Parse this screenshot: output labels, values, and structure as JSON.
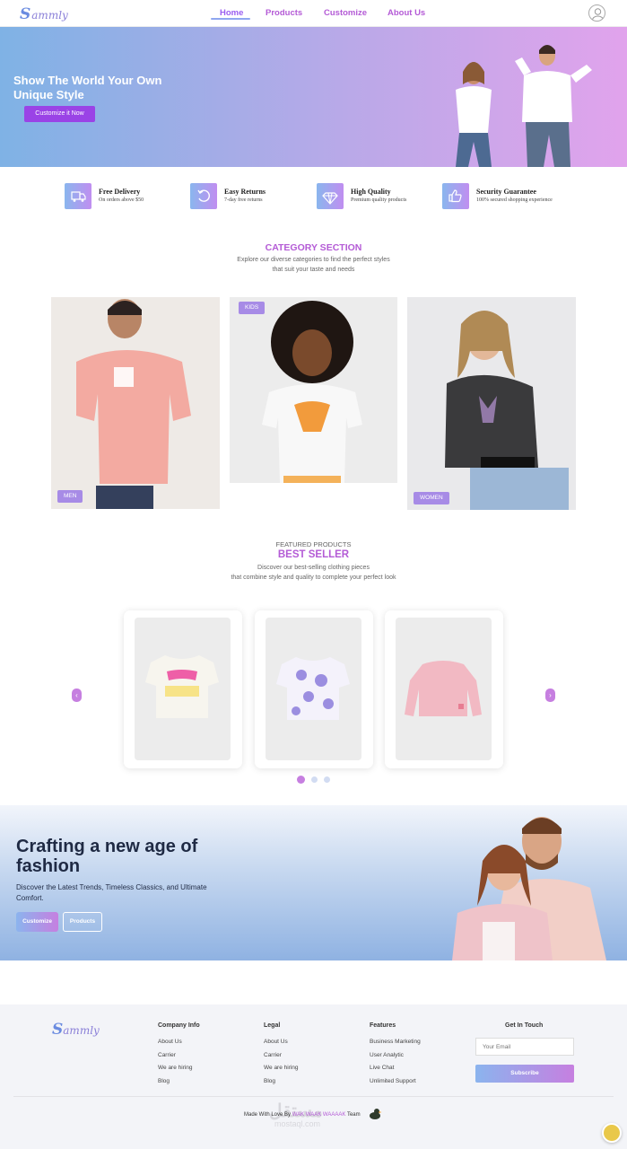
{
  "nav": {
    "logo_mark": "S",
    "logo_text": "ammly",
    "links": [
      {
        "label": "Home"
      },
      {
        "label": "Products"
      },
      {
        "label": "Customize"
      },
      {
        "label": "About Us"
      }
    ],
    "active_link": "Home"
  },
  "hero": {
    "title": "Show The World Your Own Unique Style",
    "button": "Customize it Now"
  },
  "features": [
    {
      "icon": "truck-icon",
      "title": "Free Delivery",
      "subtitle": "On orders above $50"
    },
    {
      "icon": "return-icon",
      "title": "Easy Returns",
      "subtitle": "7-day free returns"
    },
    {
      "icon": "diamond-icon",
      "title": "High Quality",
      "subtitle": "Premium quality products"
    },
    {
      "icon": "thumbs-up-icon",
      "title": "Security Guarantee",
      "subtitle": "100% secured shopping experience"
    }
  ],
  "category": {
    "title": "CATEGORY SECTION",
    "desc_line1": "Explore our diverse categories to find the perfect styles",
    "desc_line2": "that suit your taste and needs",
    "items": [
      {
        "label": "MEN"
      },
      {
        "label": "KIDS"
      },
      {
        "label": "WOMEN"
      }
    ]
  },
  "best_seller": {
    "eyebrow": "FEATURED PRODUCTS",
    "title": "BEST SELLER",
    "desc_line1": "Discover our best-selling clothing pieces",
    "desc_line2": "that combine style and quality to complete your perfect look",
    "prev": "‹",
    "next": "›",
    "active_dot": 1,
    "dot_count": 3
  },
  "banner": {
    "title": "Crafting a new age of fashion",
    "desc": "Discover the Latest Trends, Timeless Classics, and Ultimate Comfort.",
    "btn_primary": "Customize",
    "btn_secondary": "Products"
  },
  "footer": {
    "logo_mark": "S",
    "logo_text": "ammly",
    "columns": [
      {
        "title": "Company Info",
        "items": [
          "About Us",
          "Carrier",
          "We are hiring",
          "Blog"
        ]
      },
      {
        "title": "Legal",
        "items": [
          "About Us",
          "Carrier",
          "We are hiring",
          "Blog"
        ]
      },
      {
        "title": "Features",
        "items": [
          "Business Marketing",
          "User Analytic",
          "Live Chat",
          "Unlimited Support"
        ]
      }
    ],
    "contact_title": "Get In Touch",
    "email_placeholder": "Your Email",
    "subscribe": "Subscribe",
    "made_prefix": "Made With Love By",
    "made_team": "WAK WAAK WAAAAK",
    "made_suffix": "Team",
    "watermark": "مستقل",
    "watermark_sub": "mostaql.com"
  },
  "colors": {
    "accent": "#b45bd6",
    "hero_button": "#9a43e6",
    "gradient_start": "#8ab6ee",
    "gradient_end": "#c67fe0"
  }
}
